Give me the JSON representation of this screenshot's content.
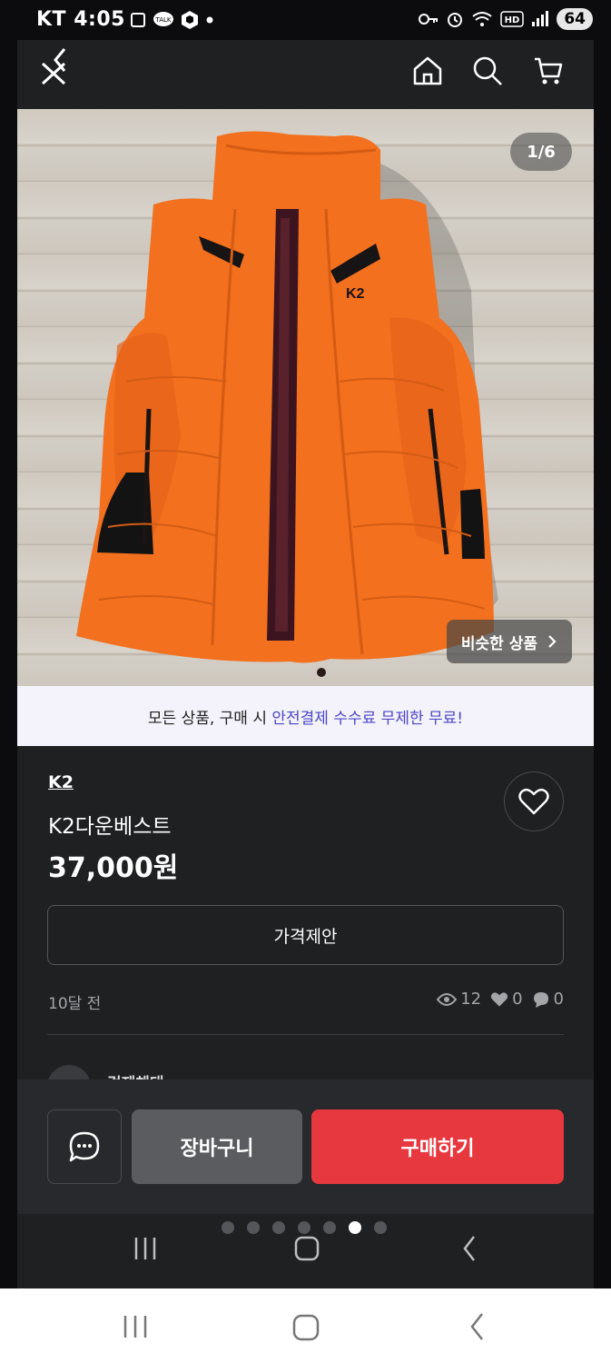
{
  "status_bar": {
    "carrier_time": "KT 4:05",
    "battery": "64"
  },
  "nav": {
    "icons": [
      "back-icon",
      "close-icon",
      "home-icon",
      "search-icon",
      "cart-icon"
    ]
  },
  "gallery": {
    "page_indicator": "1/6",
    "similar_label": "비슷한 상품",
    "brand_logo_text": "K2"
  },
  "promo": {
    "text_plain": "모든 상품, 구매 시 ",
    "text_highlight": "안전결제 수수료 무제한 무료!",
    "highlight_color": "#4b45c8"
  },
  "product": {
    "brand": "K2",
    "name": "K2다운베스트",
    "price": "37,000원",
    "offer_label": "가격제안",
    "posted": "10달 전",
    "views": "12",
    "likes": "0",
    "chats": "0"
  },
  "seller": {
    "name_partial": "검제체대"
  },
  "actions": {
    "cart_label": "장바구니",
    "buy_label": "구매하기",
    "buy_color": "#e8383f"
  },
  "carousel": {
    "count": 7,
    "active_index": 5
  }
}
